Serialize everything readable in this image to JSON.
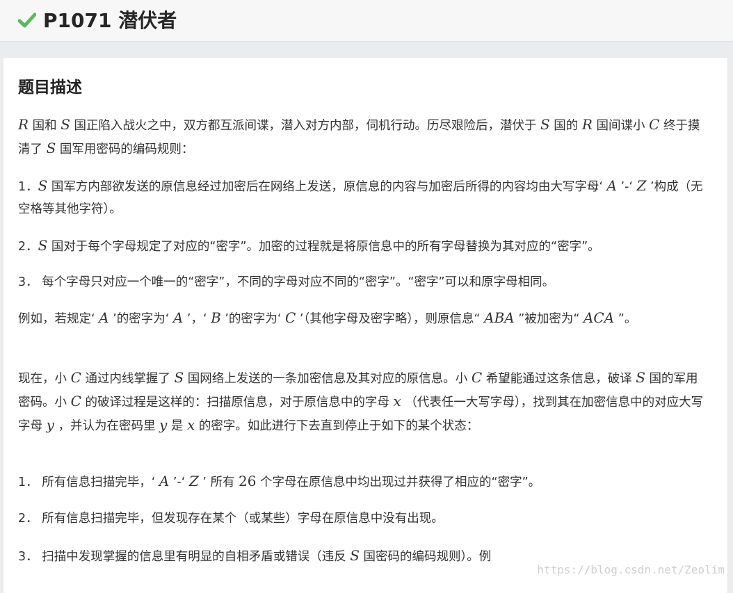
{
  "header": {
    "title": "P1071 潜伏者",
    "check_color": "#5cb85c"
  },
  "problem": {
    "heading": "题目描述",
    "p1": {
      "a": "R",
      "b": " 国和 ",
      "c": "S",
      "d": " 国正陷入战火之中，双方都互派间谍，潜入对方内部，伺机行动。历尽艰险后，潜伏于 ",
      "e": "S",
      "f": " 国的 ",
      "g": "R",
      "h": " 国间谍小 ",
      "i": "C",
      "j": " 终于摸清了 ",
      "k": "S",
      "l": " 国军用密码的编码规则："
    },
    "p2": {
      "a": "1．",
      "b": "S",
      "c": " 国军方内部欲发送的原信息经过加密后在网络上发送，原信息的内容与加密后所得的内容均由大写字母‘ ",
      "d": "A",
      "e": " ’-‘ ",
      "f": "Z",
      "g": " ’构成（无空格等其他字符）。"
    },
    "p3": {
      "a": "2．",
      "b": "S",
      "c": " 国对于每个字母规定了对应的“密字”。加密的过程就是将原信息中的所有字母替换为其对应的“密字”。"
    },
    "p4": {
      "a": "3． 每个字母只对应一个唯一的“密字”，不同的字母对应不同的“密字”。“密字”可以和原字母相同。"
    },
    "p5": {
      "a": "例如，若规定‘ ",
      "b": "A",
      "c": " ’的密字为‘ ",
      "d": "A",
      "e": " ’，‘ ",
      "f": "B",
      "g": " ’的密字为‘ ",
      "h": "C",
      "i": " ’（其他字母及密字略），则原信息“ ",
      "j": "ABA",
      "k": " ”被加密为“ ",
      "l": "ACA",
      "m": " ”。"
    },
    "p6": {
      "a": "现在，小 ",
      "b": "C",
      "c": " 通过内线掌握了 ",
      "d": "S",
      "e": " 国网络上发送的一条加密信息及其对应的原信息。小 ",
      "f": "C",
      "g": " 希望能通过这条信息，破译 ",
      "h": "S",
      "i": " 国的军用密码。小 ",
      "j": "C",
      "k": " 的破译过程是这样的：扫描原信息，对于原信息中的字母 ",
      "l": "x",
      "m": " （代表任一大写字母），找到其在加密信息中的对应大写字母 ",
      "n": "y",
      "o": " ，并认为在密码里 ",
      "p": "y",
      "q": " 是 ",
      "r": "x",
      "s": " 的密字。如此进行下去直到停止于如下的某个状态："
    },
    "p7": {
      "a": "1． 所有信息扫描完毕，‘ ",
      "b": "A",
      "c": " ’-‘ ",
      "d": "Z",
      "e": " ’ 所有 ",
      "f": "26",
      "g": " 个字母在原信息中均出现过并获得了相应的“密字”。"
    },
    "p8": {
      "a": "2． 所有信息扫描完毕，但发现存在某个（或某些）字母在原信息中没有出现。"
    },
    "p9": {
      "a": "3． 扫描中发现掌握的信息里有明显的自相矛盾或错误（违反 ",
      "b": "S",
      "c": " 国密码的编码规则）。例"
    }
  },
  "watermark": "https://blog.csdn.net/Zeolim"
}
